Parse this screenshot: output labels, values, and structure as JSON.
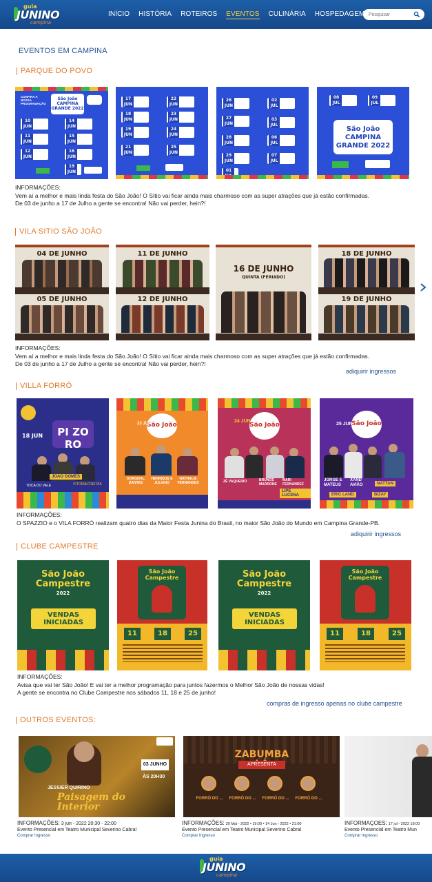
{
  "header": {
    "logo": {
      "line1": "guia",
      "line2": "JUNINO",
      "line3": "campina"
    },
    "nav": [
      "INÍCIO",
      "HISTÓRIA",
      "ROTEIROS",
      "EVENTOS",
      "CULINÁRIA",
      "HOSPEDAGEM"
    ],
    "active_nav": "EVENTOS",
    "search_placeholder": "Pesquisar",
    "color_brand": "#1d5fa8",
    "color_accent": "#ffd33d"
  },
  "page_title": "EVENTOS EM CAMPINA",
  "sections": {
    "parque": {
      "title": "PARQUE DO POVO",
      "info_label": "INFORMAÇÕES:",
      "info_text_1": "Vem aí a melhor e mais linda festa do São João!  O Sítio vai ficar ainda mais charmoso com as super atrações que já estão confirmadas.",
      "info_text_2": "De 03 de junho a 17 de Julho a gente se encontra! Não vai perder, hein?!",
      "posters": [
        {
          "top_text": "CONFIRA A NOSSA PROGRAMAÇÃO",
          "brand": "São João CAMPINA GRANDE 2022",
          "dates": [
            "10 JUN",
            "11 JUN",
            "12 JUN",
            "14 JUN",
            "15 JUN",
            "16 JUN",
            "19 JUN"
          ]
        },
        {
          "dates": [
            "17 JUN",
            "18 JUN",
            "19 JUN",
            "21 JUN",
            "22 JUN",
            "23 JUN",
            "24 JUN",
            "25 JUN"
          ]
        },
        {
          "dates": [
            "26 JUN",
            "27 JUN",
            "28 JUN",
            "29 JUN",
            "01 JUL",
            "02 JUL",
            "03 JUL",
            "06 JUL",
            "07 JUL"
          ]
        },
        {
          "dates": [
            "08 JUL",
            "09 JUL"
          ],
          "brand": "São João CAMPINA GRANDE 2022"
        }
      ]
    },
    "vila": {
      "title": "VILA SITIO SÃO JOÃO",
      "info_label": "INFORMAÇÕES:",
      "info_text_1": "Vem aí a melhor e mais linda festa do São João!  O Sítio vai ficar ainda mais charmoso com as super atrações que já estão confirmadas.",
      "info_text_2": "De 03 de junho a 17 de Julho a gente se encontra! Não vai perder, hein?!",
      "link": "adiquirir ingressos",
      "posters": [
        {
          "top": "04 DE JUNHO",
          "bottom": "05 DE JUNHO"
        },
        {
          "top": "11 DE JUNHO",
          "bottom": "12 DE JUNHO"
        },
        {
          "top": "16 DE JUNHO",
          "sub": "QUINTA (FERIADO)"
        },
        {
          "top": "18 DE JUNHO",
          "bottom": "19 DE JUNHO"
        }
      ]
    },
    "forro": {
      "title": "VILLA FORRÓ",
      "info_label": "INFORMAÇÕES:",
      "info_text_1": "O SPAZZIO e o VILA FORRÓ realizam quatro dias da Maior Festa Junina do Brasil, no maior São João do Mundo em Campina Grande-PB.",
      "link": "adiquirir ingressos",
      "posters": [
        {
          "date": "18 JUN",
          "brand": "PI ZO RO",
          "names": [
            "JOÃO GOMES",
            "TOCA DO VALE",
            "VITORIA FREITAS"
          ]
        },
        {
          "date": "23 JUN",
          "brand": "São João",
          "names": [
            "DORGIVAL DANTAS",
            "HENRIQUE E JULIANO",
            "NATHALIE FERNANDES"
          ]
        },
        {
          "date": "24 JUN",
          "brand": "São João",
          "names": [
            "ZÉ VAQUEIRO",
            "BRUNOS MARRONE",
            "MARI FERNANDEZ",
            "LIPE LUCENA"
          ]
        },
        {
          "date": "25 JUN",
          "brand": "São João",
          "names": [
            "JORGE E MATEUS",
            "XAND AVIÃO",
            "NATTAN",
            "ERIC LAND",
            "BIZAY"
          ]
        }
      ]
    },
    "campestre": {
      "title": "CLUBE CAMPESTRE",
      "info_label": "INFORMAÇÕES:",
      "info_text_1": "Avisa que vai ter São João! E vai ter a melhor programação para juntos fazermos o Melhor São João de nossas vidas!",
      "info_text_2": "A gente se encontra no Clube Campestre nos sábados 11, 18 e 25 de junho!",
      "link": "compras de ingresso apenas no clube campestre",
      "posters": [
        {
          "brand": "São João Campestre",
          "year": "2022",
          "banner": "VENDAS INICIADAS"
        },
        {
          "brand": "São João Campestre",
          "days": [
            "11",
            "18",
            "25"
          ]
        },
        {
          "brand": "São João Campestre",
          "year": "2022",
          "banner": "VENDAS INICIADAS"
        },
        {
          "brand": "São João Campestre",
          "days": [
            "11",
            "18",
            "25"
          ]
        }
      ]
    },
    "outros": {
      "title": "OUTROS EVENTOS:",
      "events": [
        {
          "label": "INFORMAÇÕES:",
          "date": "3 jun - 2022 20:30 - 22:00",
          "desc": "Evento Presencial em Teatro Municipal Severino Cabral",
          "buy": "Comprar Ingresso",
          "poster_title": "Paisagem do Interior",
          "poster_artist": "JESSIER QUIRINO",
          "poster_date": "03 JUNHO",
          "poster_time": "ÀS 20H30"
        },
        {
          "label": "INFORMAÇÕES:",
          "date": "20 Mai - 2022 • 19:00 • 14 Jun - 2022 • 21:00",
          "desc": "Evento Presencial em Teatro Municipal Severino Cabral",
          "buy": "Comprar Ingresso",
          "poster_title": "ZABUMBA LÁ",
          "poster_sub": "APRESENTA",
          "poster_names": [
            "FORRÓ DO ...",
            "FORRÓ DO ...",
            "FORRÓ DO ...",
            "FORRÓ DO ..."
          ]
        },
        {
          "label": "INFORMAÇÕES:",
          "date": "17 jul - 2022 18:00",
          "desc": "Evento Presencial em Teatro Mun",
          "buy": "Comprar Ingresso"
        }
      ]
    }
  },
  "footer": {
    "logo": {
      "line1": "guia",
      "line2": "JUNINO",
      "line3": "campina"
    }
  }
}
